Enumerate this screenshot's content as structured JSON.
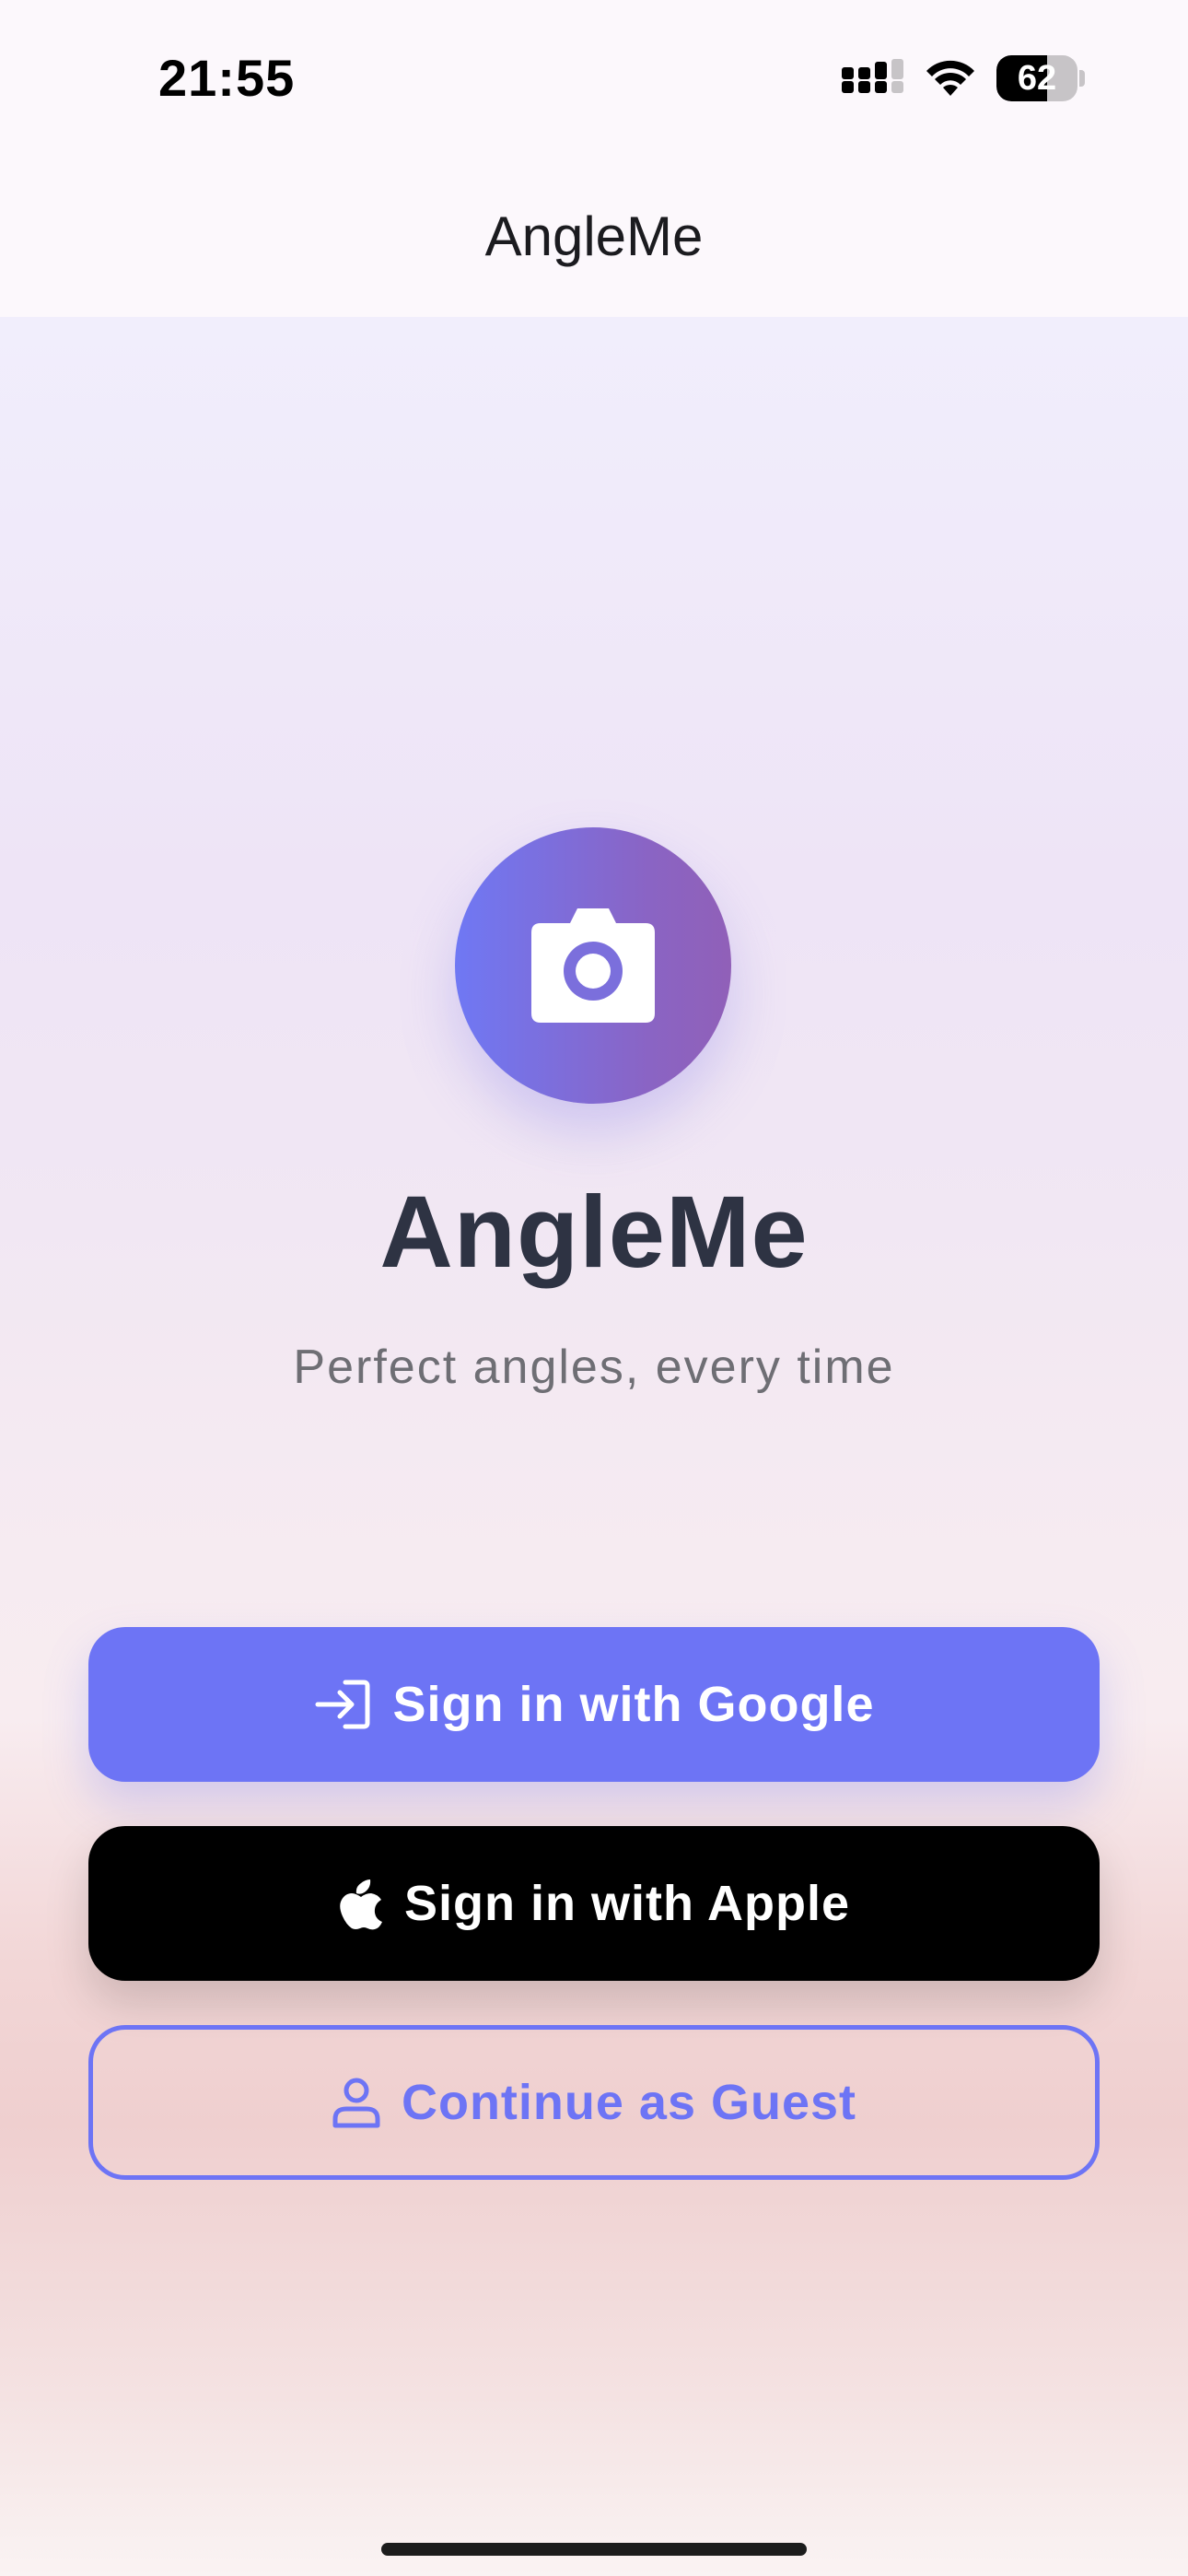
{
  "status_bar": {
    "time": "21:55",
    "battery_level": "62",
    "battery_fraction": 0.62,
    "icons": [
      "signal-icon",
      "wifi-icon",
      "battery-icon"
    ]
  },
  "nav": {
    "title": "AngleMe"
  },
  "hero": {
    "logo_icon": "camera-icon",
    "title": "AngleMe",
    "tagline": "Perfect angles, every time"
  },
  "buttons": {
    "google": {
      "label": "Sign in with Google",
      "icon": "sign-in-icon"
    },
    "apple": {
      "label": "Sign in with Apple",
      "icon": "apple-icon"
    },
    "guest": {
      "label": "Continue as Guest",
      "icon": "person-icon"
    }
  },
  "colors": {
    "accent": "#6d74f5",
    "title_text": "#2e3343",
    "tagline_text": "#6e6e74",
    "apple_button": "#000000"
  }
}
